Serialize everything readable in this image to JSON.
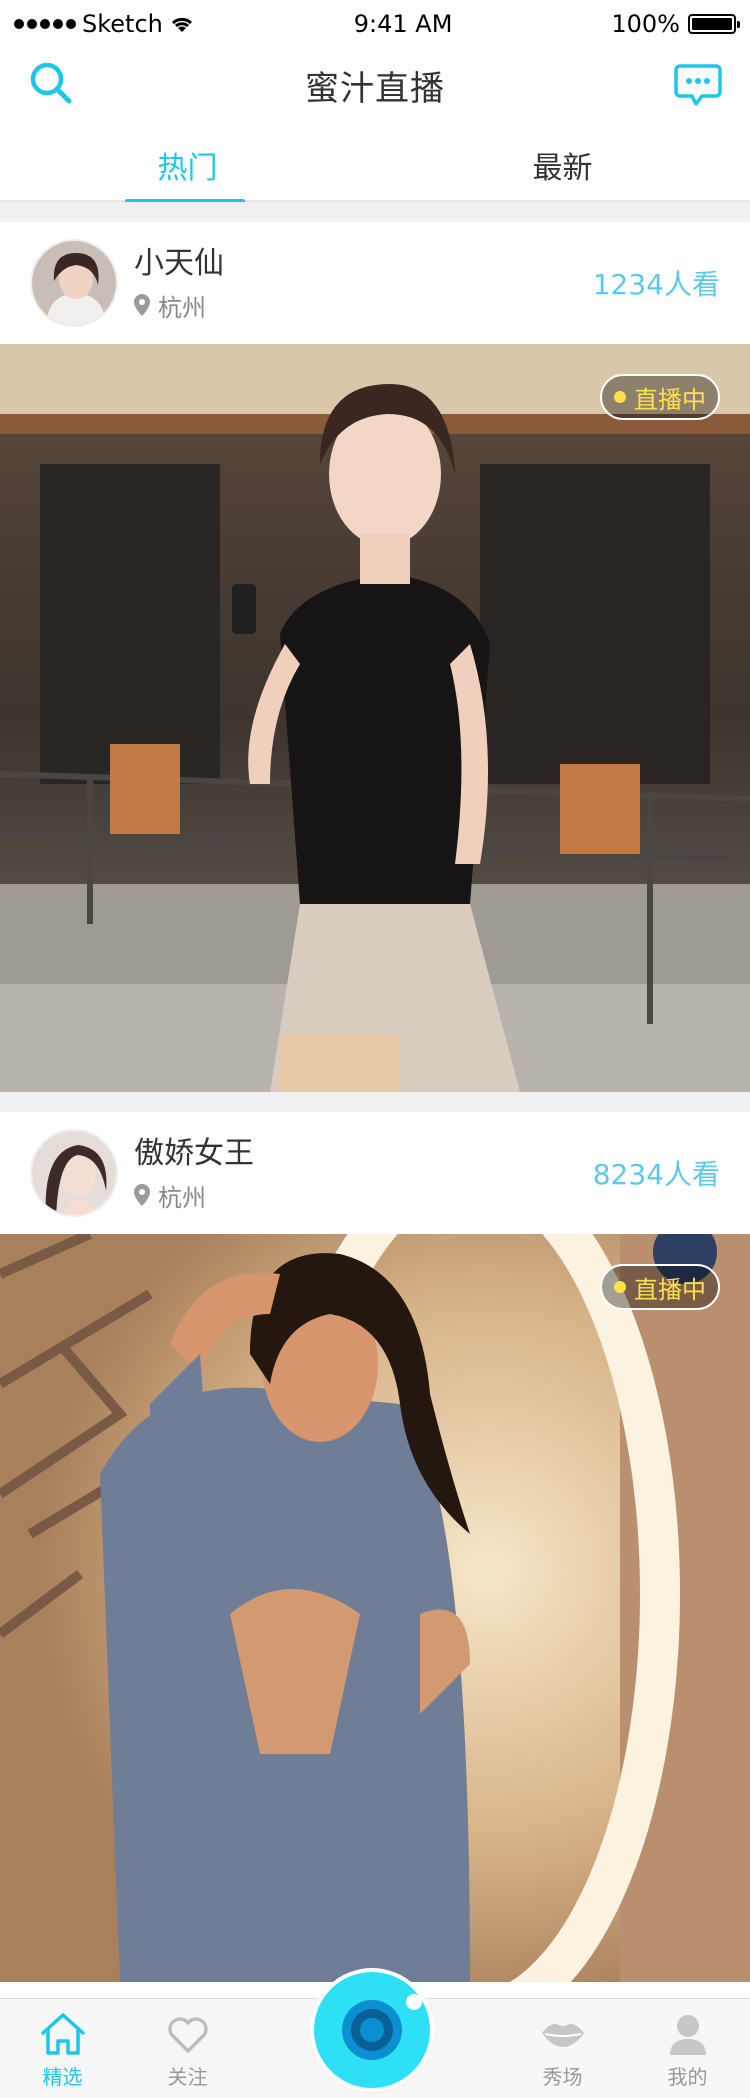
{
  "status_bar": {
    "carrier": "Sketch",
    "time": "9:41 AM",
    "battery": "100%"
  },
  "nav": {
    "title": "蜜汁直播"
  },
  "tabs": [
    {
      "label": "热门",
      "active": true
    },
    {
      "label": "最新",
      "active": false
    }
  ],
  "streams": [
    {
      "name": "小天仙",
      "location": "杭州",
      "viewers": "1234人看",
      "badge": "直播中"
    },
    {
      "name": "傲娇女王",
      "location": "杭州",
      "viewers": "8234人看",
      "badge": "直播中"
    }
  ],
  "tabbar": {
    "items": [
      {
        "label": "精选",
        "icon": "home-icon",
        "active": true
      },
      {
        "label": "关注",
        "icon": "heart-icon",
        "active": false
      },
      {
        "label": "秀场",
        "icon": "lips-icon",
        "active": false
      },
      {
        "label": "我的",
        "icon": "user-icon",
        "active": false
      }
    ]
  },
  "colors": {
    "accent": "#1cc7ea",
    "viewers": "#5bc8ec",
    "live_badge": "#ffe14a",
    "divider_bg": "#f0f0f0"
  }
}
